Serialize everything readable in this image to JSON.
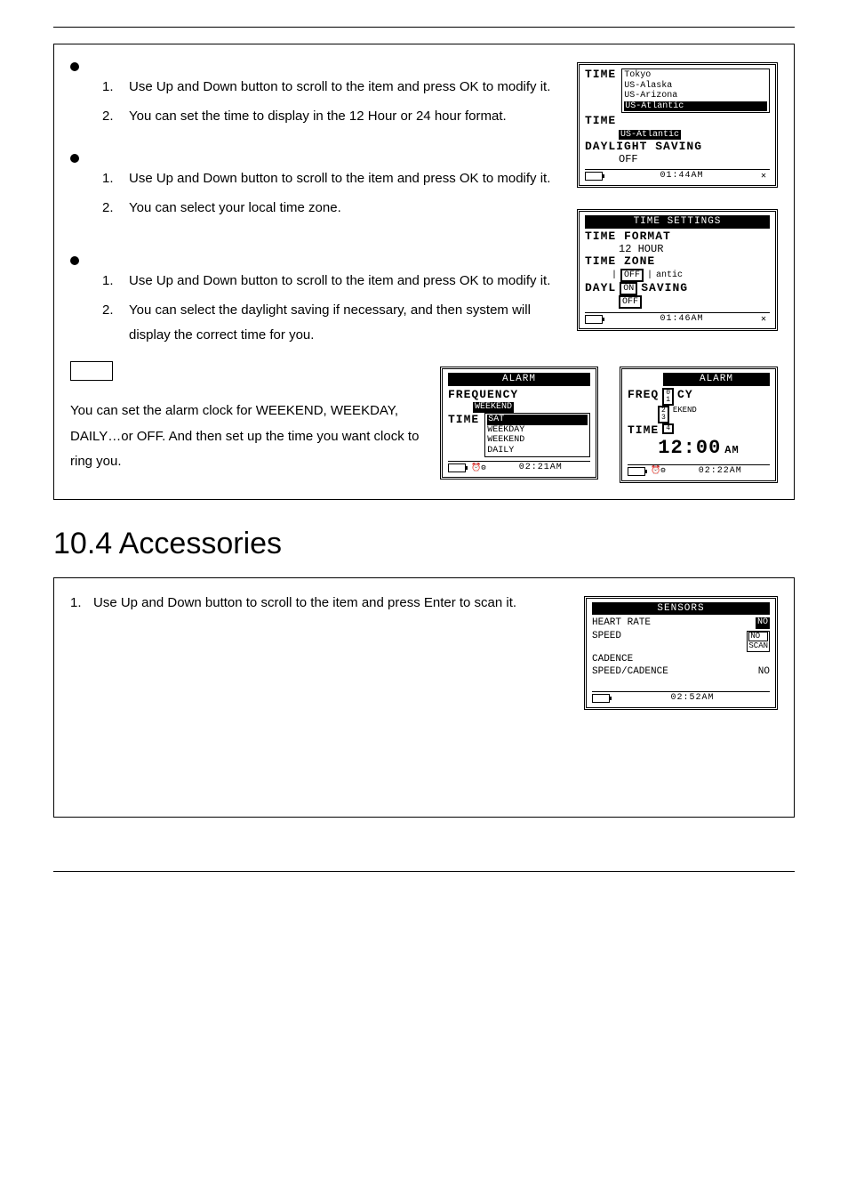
{
  "top_subsections": [
    {
      "items": [
        "Use Up and Down button to scroll to the item and press OK to modify it.",
        "You can set the time to display in the 12 Hour or 24 hour format."
      ]
    },
    {
      "items": [
        "Use Up and Down button to scroll to the item and press OK to modify it.",
        "You can select your local time zone."
      ]
    },
    {
      "items": [
        "Use Up and Down button to scroll to the item and press OK to modify it.",
        "You can select the daylight saving if necessary, and then system will display the correct time for you."
      ]
    }
  ],
  "alarm_text": "You can set the alarm clock for WEEKEND, WEEKDAY, DAILY…or OFF. And then set up the time you want clock to ring you.",
  "section_heading": "10.4 Accessories",
  "accessories_item": "Use Up and Down button to scroll to the item and press Enter to scan it.",
  "screen1": {
    "time_label": "TIME",
    "dropdown": [
      "Tokyo",
      "US-Alaska",
      "US-Arizona",
      "US-Atlantic"
    ],
    "selected": "US-Atlantic",
    "line2_label": "TIME",
    "line2_value": "US-Atlantic",
    "dst_label": "DAYLIGHT SAVING",
    "dst_value": "OFF",
    "status_time": "01:44AM"
  },
  "screen2": {
    "title": "TIME SETTINGS",
    "fmt_label": "TIME FORMAT",
    "fmt_value": "12 HOUR",
    "zone_label": "TIME ZONE",
    "zone_box": [
      "OFF",
      "ON"
    ],
    "zone_suffix": "antic",
    "dst_label": "DAYL",
    "dst_label2": "SAVING",
    "dst_value": "OFF",
    "status_time": "01:46AM"
  },
  "alarm_screen_a": {
    "title": "ALARM",
    "freq_label": "FREQUENCY",
    "freq_value": "WEEKEND",
    "time_label": "TIME",
    "dropdown": [
      "SAT",
      "WEEKDAY",
      "WEEKEND",
      "DAILY"
    ],
    "status_time": "02:21AM"
  },
  "alarm_screen_b": {
    "title": "ALARM",
    "freq_label_l": "FREQ",
    "freq_label_r": "CY",
    "freq_suffix": "EKEND",
    "overlay": [
      "0",
      "1",
      "2",
      "3",
      "4"
    ],
    "time_label": "TIME",
    "big_time": "12:00",
    "ampm": "AM",
    "status_time": "02:22AM"
  },
  "sensors": {
    "title": "SENSORS",
    "rows": [
      {
        "name": "HEART RATE",
        "val": "NO"
      },
      {
        "name": "SPEED",
        "val": ""
      },
      {
        "name": "CADENCE",
        "val": ""
      },
      {
        "name": "SPEED/CADENCE",
        "val": "NO"
      }
    ],
    "scan_options": [
      "NO",
      "SCAN"
    ],
    "status_time": "02:52AM"
  }
}
